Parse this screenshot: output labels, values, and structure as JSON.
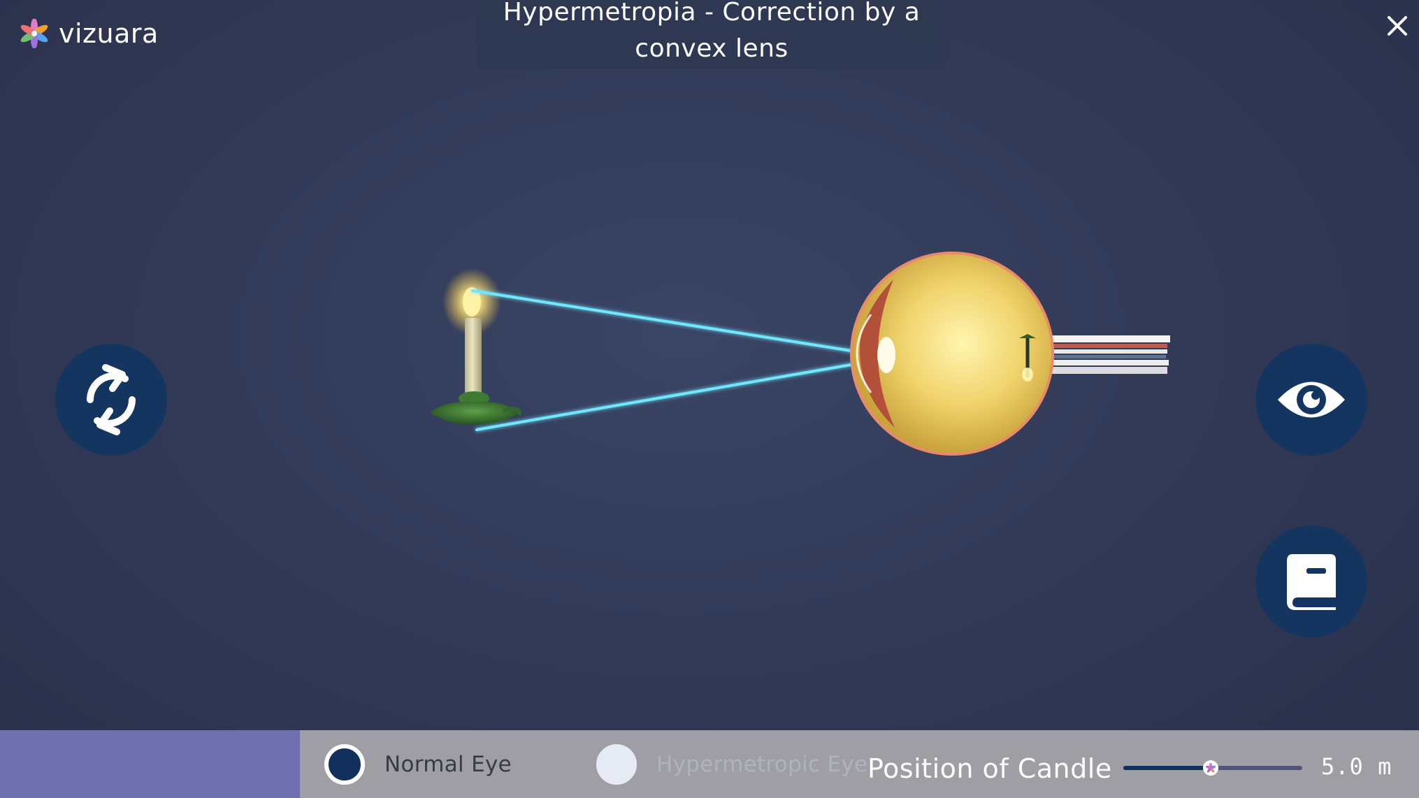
{
  "app": {
    "brand": "vizuara",
    "title": "Hypermetropia - Correction by a convex lens"
  },
  "icons": {
    "logo": "vizuara-flower-logo",
    "close": "close-icon",
    "rotate": "rotate-icon",
    "view": "eye-icon",
    "info": "book-icon"
  },
  "controls": {
    "eye_type_options": [
      {
        "label": "Normal Eye",
        "selected": true
      },
      {
        "label": "Hypermetropic Eye",
        "selected": false
      }
    ],
    "candle_position": {
      "label": "Position of Candle",
      "value_text": "5.0 m",
      "slider_fraction": 0.49
    }
  },
  "colors": {
    "button_bg": "#143560",
    "ray": "#6fe7ff",
    "bottom_bar": "#9e9ea4",
    "bottom_left_panel": "#7070b0"
  }
}
